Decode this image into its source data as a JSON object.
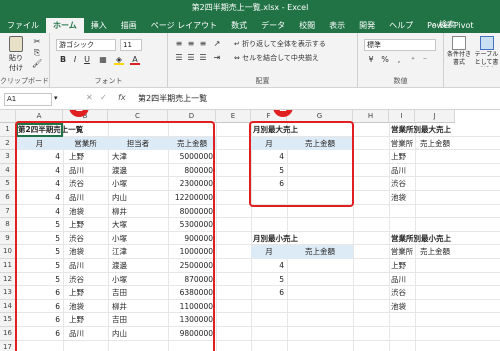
{
  "window": {
    "title": "第2四半期売上一覧.xlsx - Excel"
  },
  "ribbon_tabs": [
    "ファイル",
    "ホーム",
    "挿入",
    "描画",
    "ページ レイアウト",
    "数式",
    "データ",
    "校閲",
    "表示",
    "開発",
    "ヘルプ",
    "Power Pivot"
  ],
  "ribbon_search": "検索",
  "ribbon": {
    "clipboard_label": "クリップボード",
    "paste_label": "貼り付け",
    "font_name": "游ゴシック",
    "font_size": "11",
    "font_label": "フォント",
    "wrap_label": "折り返して全体を表示する",
    "merge_label": "セルを結合して中央揃え",
    "align_label": "配置",
    "number_format": "標準",
    "number_label": "数値",
    "cond_format_label": "条件付き書式",
    "table_format_label": "テーブルとして書式設定"
  },
  "formula_bar": {
    "name_box": "A1",
    "fx": "fx",
    "value": "第2四半期売上一覧"
  },
  "columns": [
    "A",
    "B",
    "C",
    "D",
    "E",
    "F",
    "G",
    "H",
    "I",
    "J"
  ],
  "rows": [
    "1",
    "2",
    "3",
    "4",
    "5",
    "6",
    "7",
    "8",
    "9",
    "10",
    "11",
    "12",
    "13",
    "14",
    "15",
    "16",
    "17"
  ],
  "sheet": {
    "title": "第2四半期売上一覧",
    "headers": [
      "月",
      "営業所",
      "担当者",
      "売上金額"
    ],
    "records": [
      [
        "4",
        "上野",
        "大津",
        "5000000"
      ],
      [
        "4",
        "品川",
        "渡邊",
        "800000"
      ],
      [
        "4",
        "渋谷",
        "小塚",
        "2300000"
      ],
      [
        "4",
        "品川",
        "内山",
        "12200000"
      ],
      [
        "4",
        "池袋",
        "柳井",
        "8000000"
      ],
      [
        "5",
        "上野",
        "大塚",
        "5300000"
      ],
      [
        "5",
        "渋谷",
        "小塚",
        "900000"
      ],
      [
        "5",
        "池袋",
        "江津",
        "1000000"
      ],
      [
        "5",
        "品川",
        "渡邊",
        "2500000"
      ],
      [
        "5",
        "渋谷",
        "小塚",
        "870000"
      ],
      [
        "6",
        "上野",
        "吉田",
        "6380000"
      ],
      [
        "6",
        "池袋",
        "柳井",
        "1100000"
      ],
      [
        "6",
        "上野",
        "吉田",
        "1300000"
      ],
      [
        "6",
        "品川",
        "内山",
        "9800000"
      ]
    ]
  },
  "monthly_max": {
    "title": "月別最大売上",
    "headers": [
      "月",
      "売上金額"
    ],
    "months": [
      "4",
      "5",
      "6"
    ]
  },
  "monthly_min": {
    "title": "月別最小売上",
    "headers": [
      "月",
      "売上金額"
    ],
    "months": [
      "4",
      "5",
      "6"
    ]
  },
  "office_max": {
    "title": "営業所別最大売上",
    "headers": [
      "営業所",
      "売上金額"
    ],
    "offices": [
      "上野",
      "品川",
      "渋谷",
      "池袋"
    ]
  },
  "office_min": {
    "title": "営業所別最小売上",
    "headers": [
      "営業所",
      "売上金額"
    ],
    "offices": [
      "上野",
      "品川",
      "渋谷",
      "池袋"
    ]
  },
  "markers": [
    "1",
    "2"
  ],
  "colors": {
    "excel_green": "#217346",
    "header_fill": "#ddebf7",
    "highlight_red": "#e02020"
  }
}
